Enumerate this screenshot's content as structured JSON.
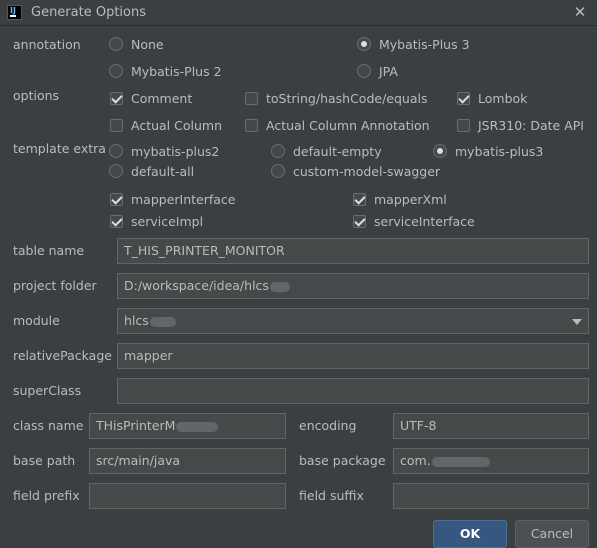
{
  "window": {
    "title": "Generate Options",
    "close_icon": "close-icon"
  },
  "annotation": {
    "label": "annotation",
    "options": [
      "None",
      "Mybatis-Plus 3",
      "Mybatis-Plus 2",
      "JPA"
    ],
    "selected": "Mybatis-Plus 3"
  },
  "options": {
    "label": "options",
    "items": [
      {
        "label": "Comment",
        "checked": true
      },
      {
        "label": "toString/hashCode/equals",
        "checked": false
      },
      {
        "label": "Lombok",
        "checked": true
      },
      {
        "label": "Actual Column",
        "checked": false
      },
      {
        "label": "Actual Column Annotation",
        "checked": false
      },
      {
        "label": "JSR310: Date API",
        "checked": false
      }
    ]
  },
  "template_extra": {
    "label": "template extra",
    "options": [
      "mybatis-plus2",
      "default-empty",
      "mybatis-plus3",
      "default-all",
      "custom-model-swagger"
    ],
    "selected": "mybatis-plus3",
    "checks": [
      {
        "label": "mapperInterface",
        "checked": true
      },
      {
        "label": "mapperXml",
        "checked": true
      },
      {
        "label": "serviceImpl",
        "checked": true
      },
      {
        "label": "serviceInterface",
        "checked": true
      }
    ]
  },
  "fields": {
    "table_name": {
      "label": "table name",
      "value": "T_HIS_PRINTER_MONITOR"
    },
    "project_folder": {
      "label": "project folder",
      "value": "D:/workspace/idea/hlcs"
    },
    "module": {
      "label": "module",
      "value": "hlcs"
    },
    "relative_package": {
      "label": "relativePackage",
      "value": "mapper"
    },
    "super_class": {
      "label": "superClass",
      "value": ""
    },
    "class_name": {
      "label": "class name",
      "value": "THisPrinterM"
    },
    "encoding": {
      "label": "encoding",
      "value": "UTF-8"
    },
    "base_path": {
      "label": "base path",
      "value": "src/main/java"
    },
    "base_package": {
      "label": "base package",
      "value": "com."
    },
    "field_prefix": {
      "label": "field prefix",
      "value": ""
    },
    "field_suffix": {
      "label": "field suffix",
      "value": ""
    }
  },
  "buttons": {
    "ok": "OK",
    "cancel": "Cancel"
  },
  "colors": {
    "background": "#3c3f41",
    "field_bg": "#45494a",
    "primary_button": "#365880"
  }
}
